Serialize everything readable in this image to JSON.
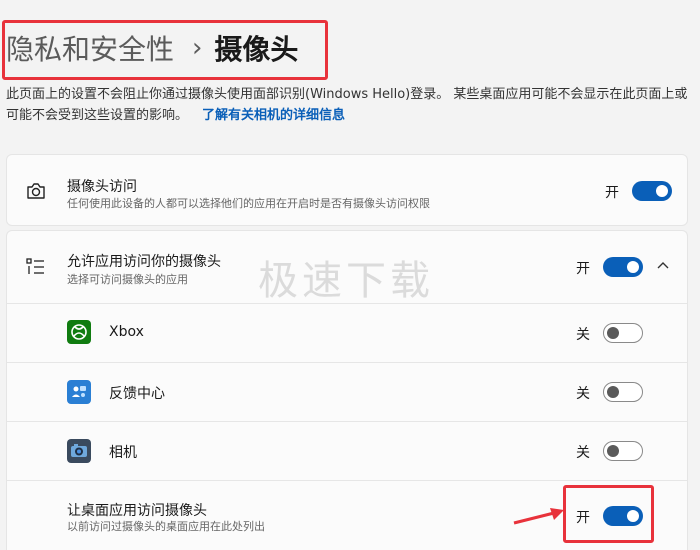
{
  "breadcrumb": {
    "parent": "隐私和安全性",
    "separator": "›",
    "current": "摄像头"
  },
  "description": {
    "text": "此页面上的设置不会阻止你通过摄像头使用面部识别(Windows Hello)登录。 某些桌面应用可能不会显示在此页面上或可能不会受到这些设置的影响。",
    "link": "了解有关相机的详细信息"
  },
  "camera_access": {
    "icon": "camera-icon",
    "title": "摄像头访问",
    "subtitle": "任何使用此设备的人都可以选择他们的应用在开启时是否有摄像头访问权限",
    "state": "开",
    "enabled": true
  },
  "app_access": {
    "icon": "app-list-icon",
    "title": "允许应用访问你的摄像头",
    "subtitle": "选择可访问摄像头的应用",
    "state": "开",
    "enabled": true,
    "expand_icon": "chevron-up-icon",
    "apps": [
      {
        "name": "Xbox",
        "icon": "xbox-icon",
        "state": "关",
        "enabled": false
      },
      {
        "name": "反馈中心",
        "icon": "feedback-hub-icon",
        "state": "关",
        "enabled": false
      },
      {
        "name": "相机",
        "icon": "camera-app-icon",
        "state": "关",
        "enabled": false
      }
    ]
  },
  "desktop_access": {
    "title": "让桌面应用访问摄像头",
    "subtitle": "以前访问过摄像头的桌面应用在此处列出",
    "state": "开",
    "enabled": true
  },
  "watermark": "极速下载",
  "colors": {
    "accent": "#0a5fb8",
    "highlight": "#e8323b",
    "xbox": "#107c10",
    "feedback": "#2a7fd4"
  }
}
